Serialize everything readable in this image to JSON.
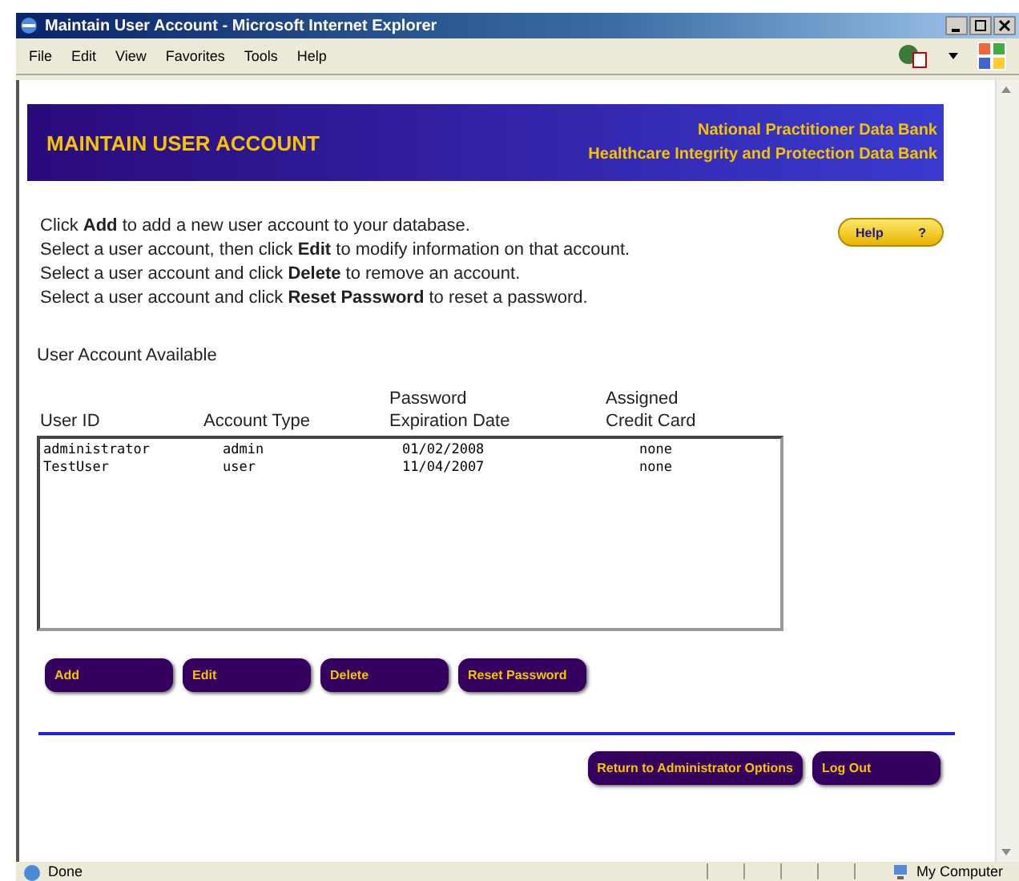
{
  "window": {
    "title": "Maintain User Account - Microsoft Internet Explorer"
  },
  "menu": [
    "File",
    "Edit",
    "View",
    "Favorites",
    "Tools",
    "Help"
  ],
  "banner": {
    "title": "MAINTAIN USER ACCOUNT",
    "org_lines": [
      "National Practitioner Data Bank",
      "Healthcare Integrity and Protection Data Bank"
    ]
  },
  "instructions": [
    "Click **Add** to add a new user account to your database.",
    "Select a user account, then click **Edit** to modify information on that account.",
    "Select a user account and click **Delete** to remove an account.",
    "Select a user account and click **Reset Password** to reset a password."
  ],
  "help_button": {
    "label": "Help",
    "icon": "?"
  },
  "section_label": "User Account Available",
  "table": {
    "columns": [
      "User ID",
      "Account Type",
      "Password\nExpiration Date",
      "Assigned\nCredit Card"
    ],
    "rows": [
      {
        "cells": [
          "administrator",
          "admin",
          "01/02/2008",
          "none"
        ],
        "selected": false
      },
      {
        "cells": [
          "TestUser",
          "user",
          "11/04/2007",
          "none"
        ],
        "selected": false
      }
    ]
  },
  "action_buttons": [
    "Add",
    "Edit",
    "Delete",
    "Reset Password"
  ],
  "footer_buttons": [
    "Return to Administrator Options",
    "Log Out"
  ],
  "status_bar": {
    "status": "Done",
    "zone": "My Computer"
  }
}
